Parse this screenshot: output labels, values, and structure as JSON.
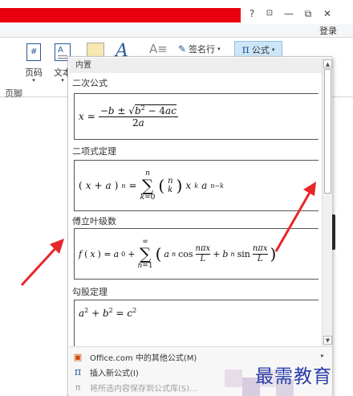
{
  "window": {
    "title_bar_color": "#e8000f",
    "help_label": "?",
    "ribbon_display_label": "⊡",
    "minimize_label": "—",
    "restore_label": "⧉",
    "close_label": "✕",
    "login_label": "登录"
  },
  "ribbon": {
    "page_number_label": "页码",
    "text_label": "文本",
    "signature_line_label": "签名行",
    "formula_label": "公式",
    "header_footer_group": "页脚"
  },
  "gallery": {
    "header": "内置",
    "items": [
      {
        "title": "二次公式",
        "equation": "x = (−b ± √(b² − 4ac)) / 2a"
      },
      {
        "title": "二项式定理",
        "equation": "(x + a)ⁿ = Σ_{k=0}^{n} (n choose k) xᵏ aⁿ⁻ᵏ"
      },
      {
        "title": "傅立叶级数",
        "equation": "f(x) = a₀ + Σ_{n=1}^{∞} (aₙ cos nπx/L + bₙ sin nπx/L)"
      },
      {
        "title": "勾股定理",
        "equation": "a² + b² = c²"
      }
    ],
    "menu": [
      {
        "label": "Office.com 中的其他公式(M)",
        "icon": "office-icon"
      },
      {
        "label": "插入新公式(I)",
        "icon": "pi-icon"
      },
      {
        "label": "将所选内容保存到公式库(S)...",
        "icon": "save-equation-icon"
      }
    ]
  },
  "watermark": {
    "text": "最需教育",
    "color": "#2a3ea8"
  },
  "colors": {
    "accent": "#2b579a",
    "arrow": "#e8262a"
  }
}
